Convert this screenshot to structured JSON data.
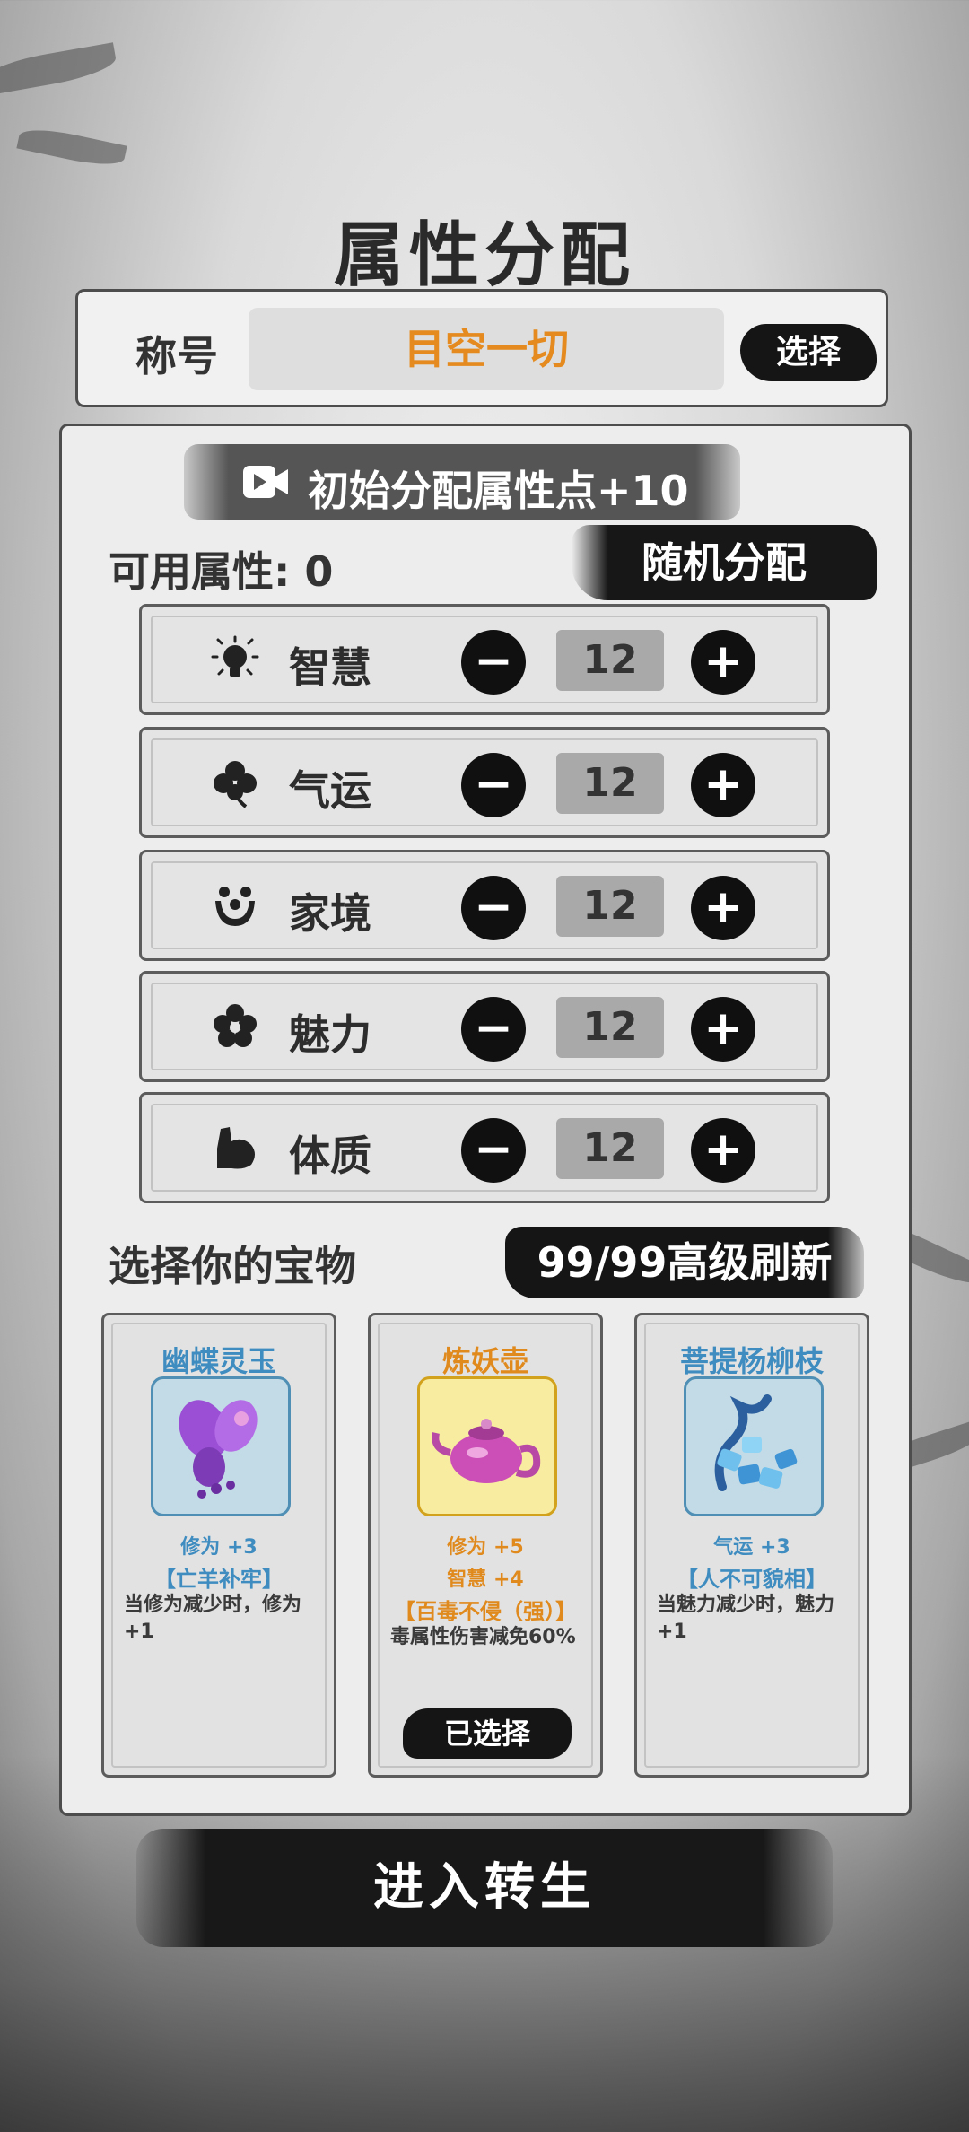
{
  "page_title": "属性分配",
  "title_section": {
    "label": "称号",
    "value": "目空一切",
    "select_label": "选择"
  },
  "ad_bonus": {
    "icon": "video-icon",
    "text": "初始分配属性点+10"
  },
  "available": {
    "label": "可用属性:",
    "value": "0"
  },
  "random_label": "随机分配",
  "attributes": [
    {
      "name": "智慧",
      "icon": "lightbulb-icon",
      "value": "12"
    },
    {
      "name": "气运",
      "icon": "clover-icon",
      "value": "12"
    },
    {
      "name": "家境",
      "icon": "family-icon",
      "value": "12"
    },
    {
      "name": "魅力",
      "icon": "flower-icon",
      "value": "12"
    },
    {
      "name": "体质",
      "icon": "muscle-icon",
      "value": "12"
    }
  ],
  "button_glyphs": {
    "minus": "−",
    "plus": "+"
  },
  "treasure_section": {
    "title": "选择你的宝物",
    "refresh_label": "99/99高级刷新"
  },
  "treasures": [
    {
      "name": "幽蝶灵玉",
      "icon": "butterfly-jade-icon",
      "stats": [
        "修为 +3"
      ],
      "skill": "【亡羊补牢】",
      "desc": "当修为减少时，修为+1"
    },
    {
      "name": "炼妖壶",
      "icon": "teapot-icon",
      "stats": [
        "修为 +5",
        "智慧 +4"
      ],
      "skill": "【百毒不侵（强）】",
      "desc": "毒属性伤害减免60%",
      "selected_label": "已选择"
    },
    {
      "name": "菩提杨柳枝",
      "icon": "willow-branch-icon",
      "stats": [
        "气运 +3"
      ],
      "skill": "【人不可貌相】",
      "desc": "当魅力减少时，魅力+1"
    }
  ],
  "enter_label": "进入转生",
  "colors": {
    "orange": "#e08a1e",
    "blue": "#3e8cc0",
    "ink": "#151515"
  }
}
